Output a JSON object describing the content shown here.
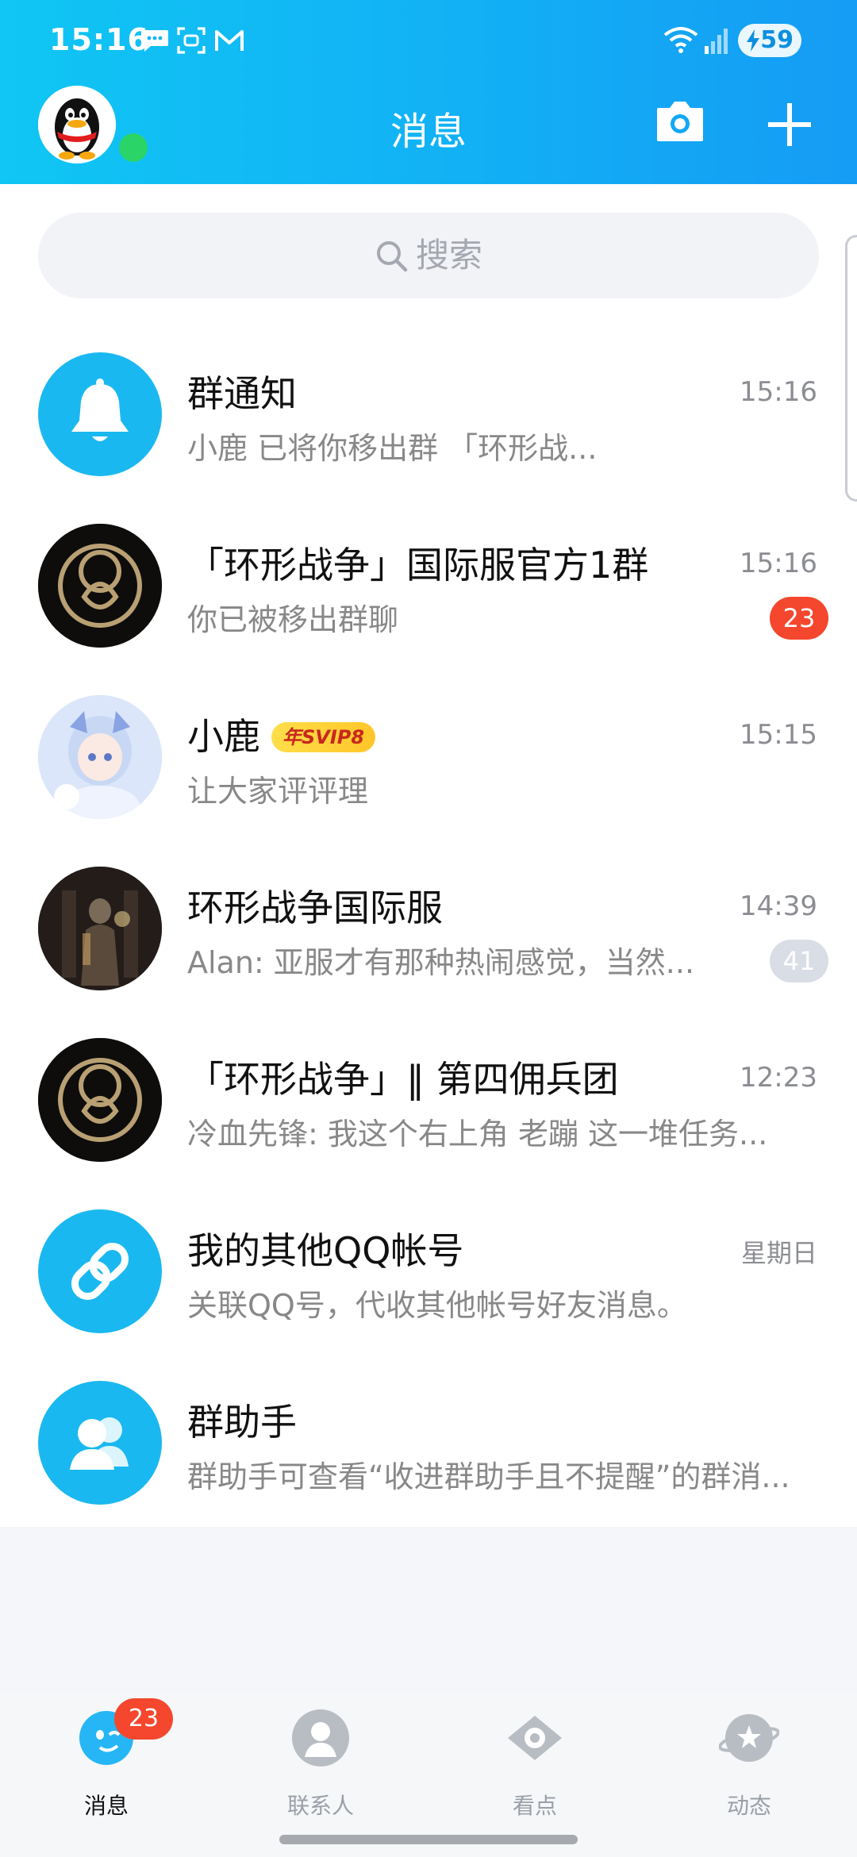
{
  "status_bar": {
    "time": "15:16",
    "battery": "59"
  },
  "header": {
    "title": "消息"
  },
  "search": {
    "placeholder": "搜索"
  },
  "chats": [
    {
      "name": "群通知",
      "preview": "小鹿 已将你移出群 「环形战...",
      "time": "15:16",
      "badge": "",
      "avatar_icon": "bell-icon"
    },
    {
      "name": "「环形战争」国际服官方1群",
      "preview": "你已被移出群聊",
      "time": "15:16",
      "badge": "23",
      "avatar_icon": "ring-logo-icon"
    },
    {
      "name": "小鹿",
      "vip": "年SVIP8",
      "preview": "让大家评评理",
      "time": "15:15",
      "badge": "",
      "avatar_icon": "anime-girl-avatar"
    },
    {
      "name": "环形战争国际服",
      "preview": "Alan: 亚服才有那种热闹感觉，当然...",
      "time": "14:39",
      "badge": "41",
      "avatar_icon": "knight-avatar"
    },
    {
      "name": "「环形战争」‖ 第四佣兵团",
      "preview": "冷血先锋: 我这个右上角 老蹦 这一堆任务...",
      "time": "12:23",
      "badge": "",
      "avatar_icon": "ring-logo-icon"
    },
    {
      "name": "我的其他QQ帐号",
      "preview": "关联QQ号，代收其他帐号好友消息。",
      "time": "星期日",
      "badge": "",
      "avatar_icon": "link-icon"
    },
    {
      "name": "群助手",
      "preview": "群助手可查看“收进群助手且不提醒”的群消...",
      "time": "",
      "badge": "",
      "avatar_icon": "group-helper-icon"
    }
  ],
  "tabs": [
    {
      "label": "消息",
      "badge": "23",
      "active": true
    },
    {
      "label": "联系人"
    },
    {
      "label": "看点"
    },
    {
      "label": "动态"
    }
  ],
  "colors": {
    "header_start": "#10c6f4",
    "header_end": "#159cf4",
    "badge_red": "#f4472d",
    "online_green": "#2bd467",
    "accent_blue": "#1ab8f0"
  }
}
